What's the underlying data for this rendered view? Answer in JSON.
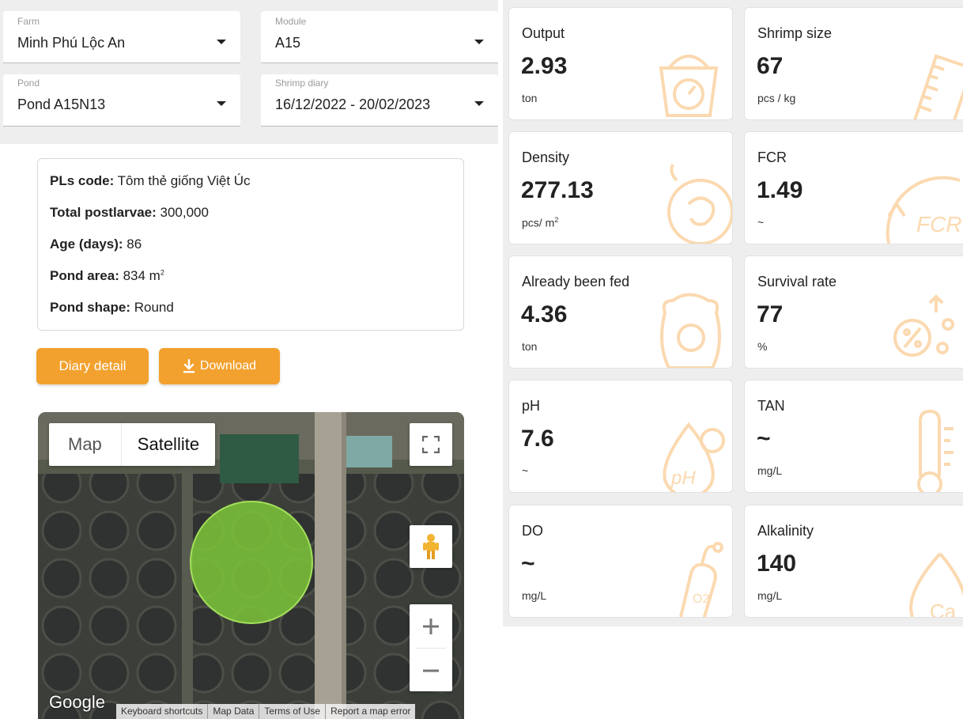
{
  "filters": {
    "farm": {
      "label": "Farm",
      "value": "Minh Phú Lộc An"
    },
    "module": {
      "label": "Module",
      "value": "A15"
    },
    "pond": {
      "label": "Pond",
      "value": "Pond A15N13"
    },
    "diary": {
      "label": "Shrimp diary",
      "value": "16/12/2022 - 20/02/2023"
    }
  },
  "info": {
    "pls_code": {
      "label": "PLs code:",
      "value": " Tôm thẻ giống Việt Úc"
    },
    "total_postlarvae": {
      "label": "Total postlarvae:",
      "value": " 300,000"
    },
    "age": {
      "label": "Age (days):",
      "value": " 86"
    },
    "pond_area": {
      "label": "Pond area:",
      "value": " 834 m",
      "sup": "2"
    },
    "pond_shape": {
      "label": "Pond shape:",
      "value": " Round"
    }
  },
  "buttons": {
    "diary_detail": "Diary detail",
    "download": "Download"
  },
  "map": {
    "type_map": "Map",
    "type_satellite": "Satellite",
    "logo": "Google",
    "attribution": [
      "Keyboard shortcuts",
      "Map Data",
      "Terms of Use",
      "Report a map error"
    ]
  },
  "cards": [
    {
      "title": "Output",
      "value": "2.93",
      "unit": "ton",
      "icon": "scale-icon"
    },
    {
      "title": "Shrimp size",
      "value": "67",
      "unit": "pcs / kg",
      "icon": "ruler-icon"
    },
    {
      "title": "Density",
      "value": "277.13",
      "unit": "pcs/ m",
      "unit_sup": "2",
      "icon": "shrimp-icon"
    },
    {
      "title": "FCR",
      "value": "1.49",
      "unit": "~",
      "icon": "fcr-icon"
    },
    {
      "title": "Already been fed",
      "value": "4.36",
      "unit": "ton",
      "icon": "feed-bag-icon"
    },
    {
      "title": "Survival rate",
      "value": "77",
      "unit": "%",
      "icon": "percent-icon"
    },
    {
      "title": "pH",
      "value": "7.6",
      "unit": "~",
      "icon": "ph-drop-icon"
    },
    {
      "title": "TAN",
      "value": "~",
      "unit": "mg/L",
      "icon": "thermometer-icon"
    },
    {
      "title": "DO",
      "value": "~",
      "unit": "mg/L",
      "icon": "oxygen-tank-icon"
    },
    {
      "title": "Alkalinity",
      "value": "140",
      "unit": "mg/L",
      "icon": "calcium-drop-icon"
    }
  ],
  "colors": {
    "accent": "#f3a12e",
    "icon_tint": "#fbd9b0",
    "pond_marker": "#7dc63a"
  }
}
